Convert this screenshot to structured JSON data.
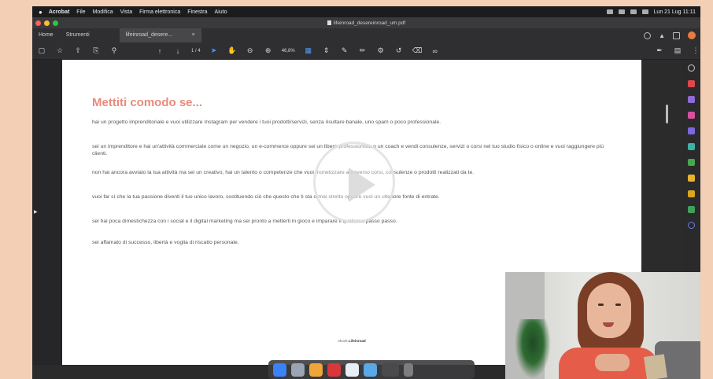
{
  "menubar": {
    "app_name": "Acrobat",
    "items": [
      "File",
      "Modifica",
      "Vista",
      "Firma elettronica",
      "Finestra",
      "Aiuto"
    ],
    "clock": "Lun 21 Lug 11:11"
  },
  "window": {
    "title": "lifeinroad_desereinroad_um.pdf"
  },
  "tabs": {
    "home": "Home",
    "tools": "Strumenti",
    "document": "lifeinroad_desere..."
  },
  "toolbar": {
    "page_indicator": "1 / 4",
    "zoom": "46,8%"
  },
  "document": {
    "heading": "Mettiti comodo se...",
    "paragraphs": [
      "hai un progetto imprenditoriale e vuoi utilizzare Instagram per vendere i tuoi prodotti/servizi, senza risultare banale, uno spam o poco professionale.",
      "sei un imprenditore e hai un'attività commerciale come un negozio, un e-commerce oppure sei un libero professionista o un coach e vendi consulenze, servizi o corsi nel tuo studio fisico o online e vuoi raggiungere più clienti.",
      "non hai ancora avviato la tua attività ma sei un creativo, hai un talento o competenze che vuoi monetizzare attraverso corsi, consulenze o prodotti realizzati da te.",
      "vuoi far sì che la tua passione diventi il tuo unico lavoro, sostituendo ciò che questo che ti sta ormai stretto oppure vuoi un ulteriore fonte di entrate.",
      "sei hai poca dimestichezza con i social e il digital marketing ma sei pronto a metterti in gioco e imparare il qualcosa passo passo.",
      "sei affamato di successo, libertà e voglia di riscatto personale."
    ],
    "footer_prefix": "ebook",
    "footer_brand": "Lifeinroad"
  },
  "icons": {
    "play": "play-icon",
    "apple": "apple-icon"
  },
  "colors": {
    "heading": "#e98a7c",
    "background": "#f3cfb5",
    "accent": "#4c9bff"
  }
}
